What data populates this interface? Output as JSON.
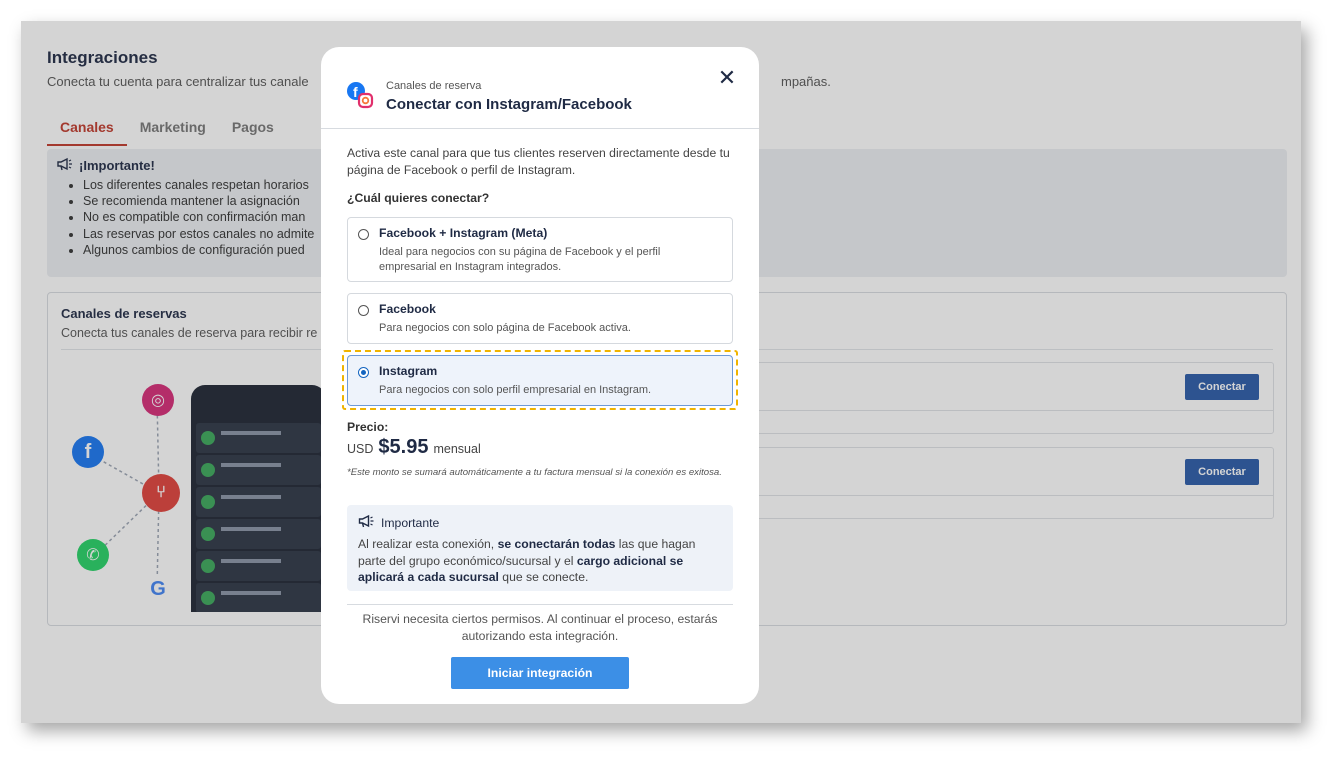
{
  "background": {
    "title": "Integraciones",
    "subtitle_start": "Conecta tu cuenta para centralizar tus canale",
    "subtitle_end": "mpañas.",
    "tabs": [
      "Canales",
      "Marketing",
      "Pagos"
    ],
    "notice_title": "¡Importante!",
    "notice_items": [
      "Los diferentes canales respetan horarios",
      "Se recomienda mantener la asignación",
      "No es compatible con confirmación man",
      "Las reservas por estos canales no admite",
      "Algunos cambios de configuración pued"
    ],
    "card_title": "Canales de reservas",
    "card_subtitle": "Conecta tus canales de reserva para recibir re",
    "connect_label": "Conectar"
  },
  "modal": {
    "kicker": "Canales de reserva",
    "title": "Conectar con Instagram/Facebook",
    "description": "Activa este canal para que tus clientes reserven directamente desde tu página de Facebook o perfil de Instagram.",
    "question": "¿Cuál quieres conectar?",
    "options": [
      {
        "title": "Facebook + Instagram (Meta)",
        "desc": "Ideal para negocios con su página de Facebook y el perfil empresarial en Instagram integrados.",
        "selected": false
      },
      {
        "title": "Facebook",
        "desc": "Para negocios con solo página de Facebook activa.",
        "selected": false
      },
      {
        "title": "Instagram",
        "desc": "Para negocios con solo perfil empresarial en Instagram.",
        "selected": true
      }
    ],
    "price_label": "Precio:",
    "currency": "USD",
    "price": "$5.95",
    "period": "mensual",
    "price_note": "*Este monto se sumará automáticamente a tu factura mensual si la conexión es exitosa.",
    "important_title": "Importante",
    "important_p1": "Al realizar esta conexión, ",
    "important_b1": "se conectarán todas",
    "important_p2": " las que hagan parte del grupo económico/sucursal y el ",
    "important_b2": "cargo adicional se aplicará a cada sucursal",
    "important_p3": " que se conecte.",
    "permissions": "Riservi necesita ciertos permisos. Al continuar el proceso, estarás autorizando esta integración.",
    "start_button": "Iniciar integración"
  },
  "colors": {
    "accent": "#3c8fe6",
    "tab_active": "#c0392b",
    "highlight": "#f0b400",
    "connect_button": "#2a5aa8"
  }
}
